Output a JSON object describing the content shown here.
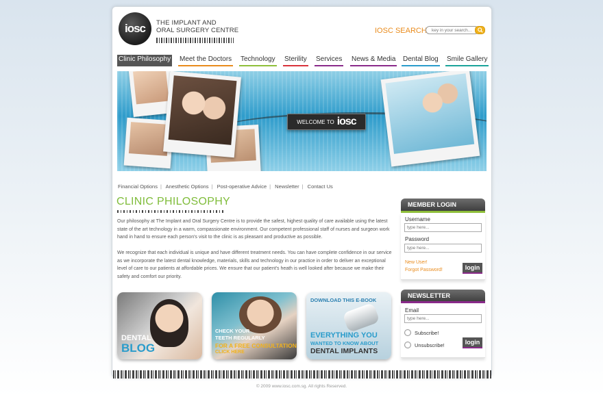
{
  "header": {
    "logo_mark": "iosc",
    "logo_line1": "THE IMPLANT AND",
    "logo_line2": "ORAL SURGERY CENTRE",
    "search_label": "IOSC SEARCH",
    "search_placeholder": "key in your search..."
  },
  "nav": [
    {
      "label": "Clinic Philosophy",
      "color": "#555555",
      "active": true
    },
    {
      "label": "Meet the Doctors",
      "color": "#e98b1c"
    },
    {
      "label": "Technology",
      "color": "#8fbf3a"
    },
    {
      "label": "Sterility",
      "color": "#d9323a"
    },
    {
      "label": "Services",
      "color": "#8a2a8a"
    },
    {
      "label": "News & Media",
      "color": "#8a2a8a"
    },
    {
      "label": "Dental Blog",
      "color": "#2a9ccb"
    },
    {
      "label": "Smile Gallery",
      "color": "#1aa39a"
    }
  ],
  "banner": {
    "welcome_text": "WELCOME TO",
    "welcome_brand": "iosc"
  },
  "sublinks": [
    "Financial Options",
    "Anesthetic Options",
    "Post-operative Advice",
    "Newsletter",
    "Contact Us"
  ],
  "main": {
    "title": "CLINIC PHILOSOPHY",
    "para1": "Our philosophy at The Implant and Oral Surgery Centre is to provide the safest, highest quality of care available using the latest state of the art technology in a warm, compassionate environment. Our competent professional staff of nurses and surgeon work hand in hand to ensure each person's visit to the clinic is as pleasant and productive as possible.",
    "para2": "We recognize that each individual is unique and have different treatment needs.  You can have complete confidence in our service as we incorporate the latest dental knowledge, materials, skills and technology in our practice in order to deliver an exceptional level of care to our patients at affordable prices.  We ensure that our patient's heath is well looked after because we make their safety and comfort our priority."
  },
  "promos": {
    "blog_line1": "DENTAL",
    "blog_line2": "BLOG",
    "check_line1": "CHECK YOUR",
    "check_line2": "TEETH REGULARLY",
    "check_line3": "FOR A FREE CONSULTATION",
    "check_line4": "CLICK HERE",
    "ebook_line1": "DOWNLOAD THIS E-BOOK",
    "ebook_line2": "EVERYTHING YOU",
    "ebook_line3": "WANTED TO KNOW ABOUT",
    "ebook_line4": "DENTAL IMPLANTS"
  },
  "member_login": {
    "title": "MEMBER LOGIN",
    "accent": "#8fbf3a",
    "username_label": "Username",
    "username_placeholder": "type here...",
    "password_label": "Password",
    "password_placeholder": "type here...",
    "new_user": "New User!",
    "forgot": "Forgot Password!",
    "login": "login"
  },
  "newsletter": {
    "title": "NEWSLETTER",
    "accent": "#8a2a8a",
    "email_label": "Email",
    "email_placeholder": "type here...",
    "subscribe": "Subscribe!",
    "unsubscribe": "Unsubscribe!",
    "login": "login"
  },
  "footer": {
    "copyright": "© 2009 www.iosc.com.sg. All rights Reserved."
  }
}
